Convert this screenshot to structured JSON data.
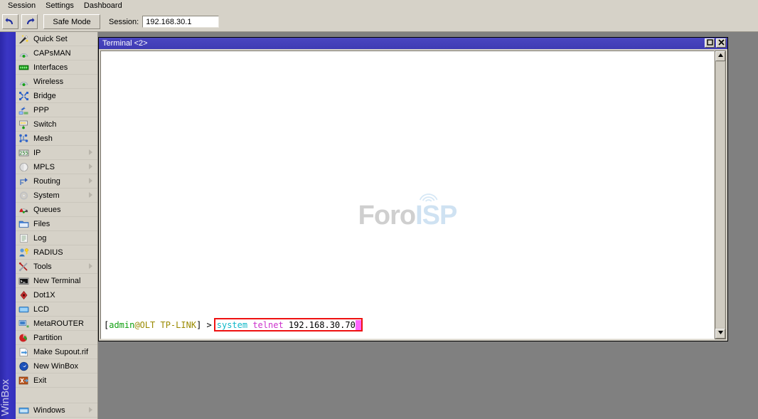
{
  "menubar": {
    "items": [
      {
        "label": "Session",
        "name": "menu-session"
      },
      {
        "label": "Settings",
        "name": "menu-settings"
      },
      {
        "label": "Dashboard",
        "name": "menu-dashboard"
      }
    ]
  },
  "toolbar": {
    "undo_icon": "undo-icon",
    "redo_icon": "redo-icon",
    "safe_mode_label": "Safe Mode",
    "session_label": "Session:",
    "session_value": "192.168.30.1"
  },
  "bluestrip": {
    "label": "WinBox",
    "color": "#3430bd"
  },
  "sidebar": {
    "items": [
      {
        "label": "Quick Set",
        "icon": "wand-icon",
        "arrow": false
      },
      {
        "label": "CAPsMAN",
        "icon": "antenna-icon",
        "arrow": false
      },
      {
        "label": "Interfaces",
        "icon": "interfaces-icon",
        "arrow": false
      },
      {
        "label": "Wireless",
        "icon": "antenna-icon",
        "arrow": false
      },
      {
        "label": "Bridge",
        "icon": "bridge-icon",
        "arrow": false
      },
      {
        "label": "PPP",
        "icon": "ppp-icon",
        "arrow": false
      },
      {
        "label": "Switch",
        "icon": "switch-icon",
        "arrow": false
      },
      {
        "label": "Mesh",
        "icon": "mesh-icon",
        "arrow": false
      },
      {
        "label": "IP",
        "icon": "ip-255-icon",
        "arrow": true
      },
      {
        "label": "MPLS",
        "icon": "mpls-icon",
        "arrow": true
      },
      {
        "label": "Routing",
        "icon": "routing-icon",
        "arrow": true
      },
      {
        "label": "System",
        "icon": "system-gear-icon",
        "arrow": true
      },
      {
        "label": "Queues",
        "icon": "queues-icon",
        "arrow": false
      },
      {
        "label": "Files",
        "icon": "folder-icon",
        "arrow": false
      },
      {
        "label": "Log",
        "icon": "log-icon",
        "arrow": false
      },
      {
        "label": "RADIUS",
        "icon": "radius-icon",
        "arrow": false
      },
      {
        "label": "Tools",
        "icon": "tools-icon",
        "arrow": true
      },
      {
        "label": "New Terminal",
        "icon": "terminal-icon",
        "arrow": false
      },
      {
        "label": "Dot1X",
        "icon": "dot1x-icon",
        "arrow": false
      },
      {
        "label": "LCD",
        "icon": "lcd-icon",
        "arrow": false
      },
      {
        "label": "MetaROUTER",
        "icon": "metarouter-icon",
        "arrow": false
      },
      {
        "label": "Partition",
        "icon": "partition-icon",
        "arrow": false
      },
      {
        "label": "Make Supout.rif",
        "icon": "supout-icon",
        "arrow": false
      },
      {
        "label": "New WinBox",
        "icon": "winbox-icon",
        "arrow": false
      },
      {
        "label": "Exit",
        "icon": "exit-icon",
        "arrow": false
      }
    ],
    "footer": {
      "label": "Windows",
      "icon": "windows-icon",
      "arrow": true
    }
  },
  "terminal": {
    "title": "Terminal <2>",
    "title_bar_color": "#3f3bb4",
    "maximize_icon": "maximize-icon",
    "close_icon": "close-icon",
    "watermark": {
      "part1": "Foro",
      "part2": "ISP",
      "color1": "#cfcfcf",
      "color2": "#cfe2f2"
    },
    "prompt": {
      "open_bracket": "[",
      "user": "admin",
      "at_host": "@OLT TP-LINK",
      "close_bracket": "]",
      "symbol": " >",
      "user_color": "#11a011",
      "host_color": "#9a8a00"
    },
    "command": {
      "word1": "system",
      "word2": " telnet",
      "argument": " 192.168.30.70",
      "word1_color": "#0fb8c8",
      "word2_color": "#cc33cc",
      "argument_color": "#000000",
      "cursor_color": "#ff66ff",
      "highlight_color": "#ee1111"
    },
    "scrollbar": {
      "up_icon": "scroll-up-icon",
      "down_icon": "scroll-down-icon"
    }
  }
}
